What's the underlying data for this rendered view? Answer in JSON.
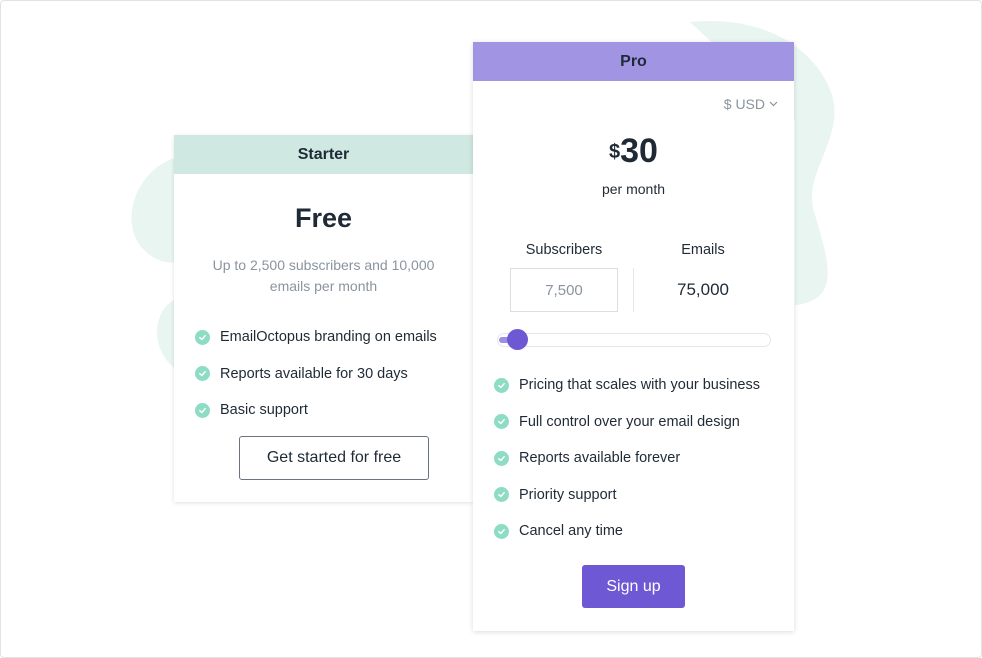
{
  "colors": {
    "starter_header": "#cfe8e1",
    "pro_header": "#a195e3",
    "accent": "#6e58d4",
    "check": "#8fdcc5",
    "blob": "#e8f5f1"
  },
  "starter": {
    "header": "Starter",
    "title": "Free",
    "description": "Up to 2,500 subscribers and 10,000 emails per month",
    "features": [
      "EmailOctopus branding on emails",
      "Reports available for 30 days",
      "Basic support"
    ],
    "button_label": "Get started for free"
  },
  "pro": {
    "header": "Pro",
    "currency": "$ USD",
    "price_symbol": "$",
    "price_amount": "30",
    "price_period": "per month",
    "subscribers_label": "Subscribers",
    "subscribers_value": "7,500",
    "emails_label": "Emails",
    "emails_value": "75,000",
    "slider_fraction": 0.03,
    "features": [
      "Pricing that scales with your business",
      "Full control over your email design",
      "Reports available forever",
      "Priority support",
      "Cancel any time"
    ],
    "button_label": "Sign up"
  }
}
